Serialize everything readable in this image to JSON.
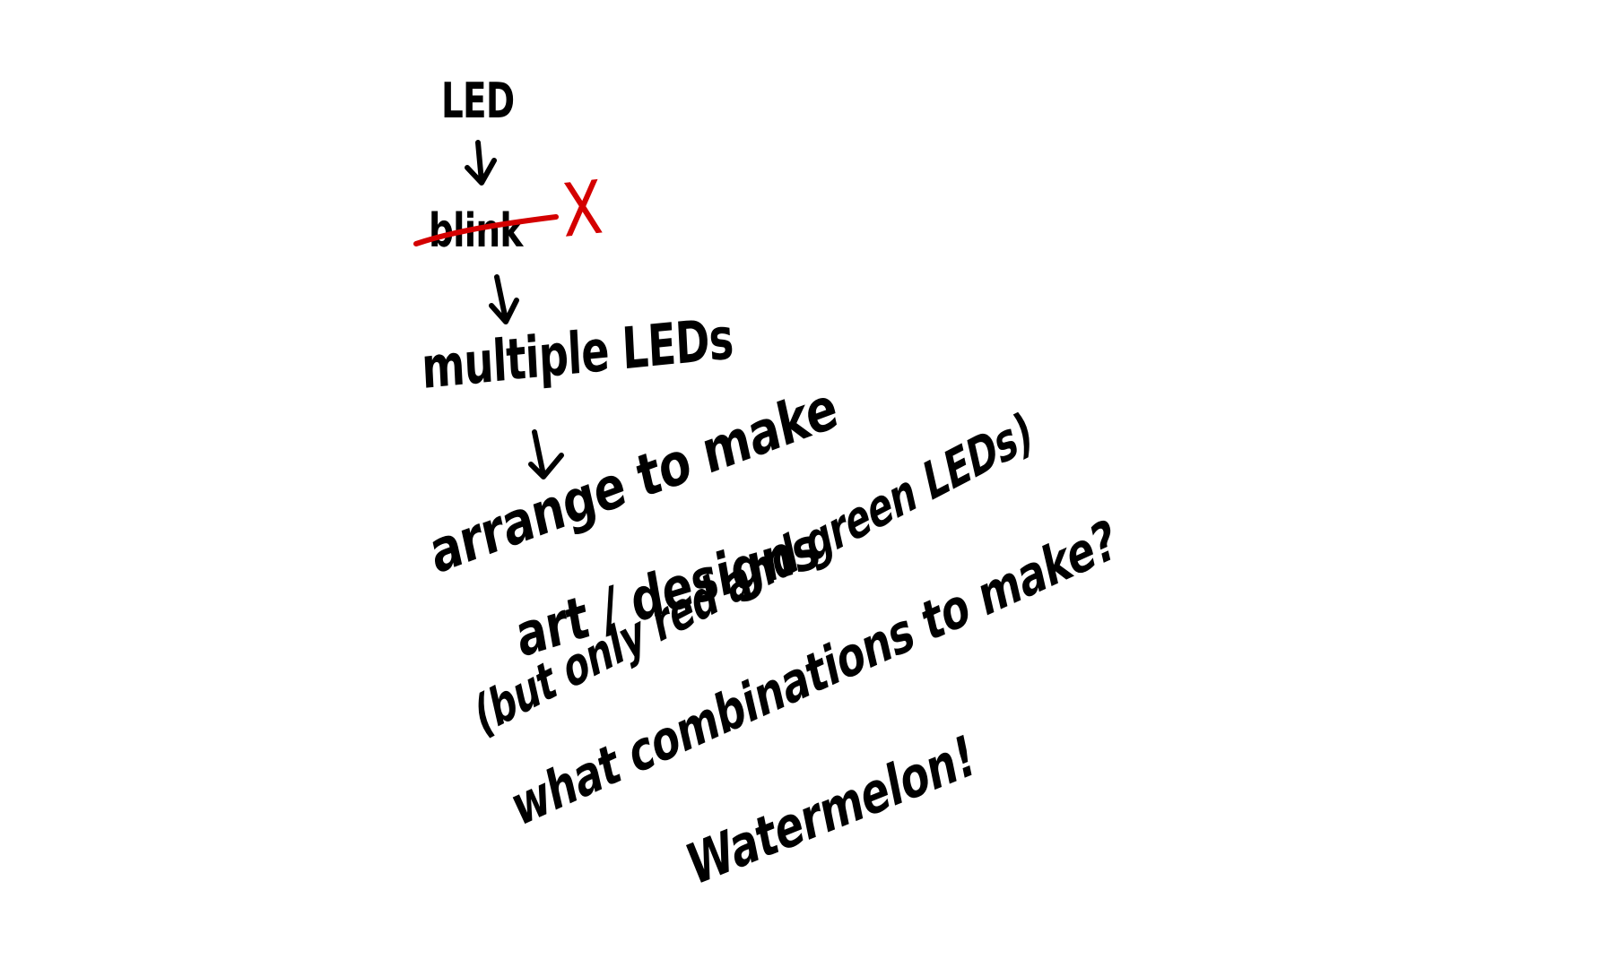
{
  "notes": {
    "step1": "LED",
    "step2": "blink",
    "step3": "multiple LEDs",
    "step4a": "arrange to make",
    "step4b": "art / designs",
    "step5": "(but only red and green LEDs)",
    "step6": "what combinations to make?",
    "step7": "Watermelon!",
    "rejected_mark": "X"
  },
  "colors": {
    "ink": "#000000",
    "correction": "#d40000",
    "background": "#ffffff"
  }
}
